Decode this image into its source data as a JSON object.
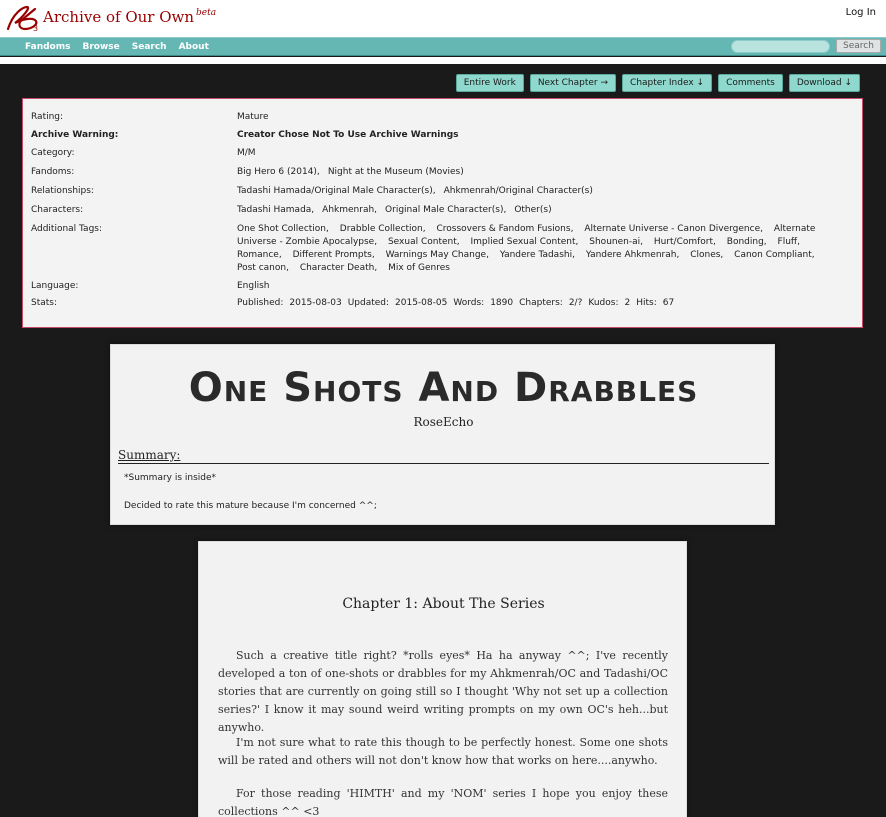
{
  "header": {
    "site_title": "Archive of Our Own",
    "beta_label": "beta",
    "login_label": "Log In",
    "nav": [
      "Fandoms",
      "Browse",
      "Search",
      "About"
    ],
    "search_placeholder": "",
    "search_button": "Search",
    "brand_color": "#990000",
    "nav_color": "#64b7b3"
  },
  "actions": [
    "Entire Work",
    "Next Chapter →",
    "Chapter Index ↓",
    "Comments",
    "Download ↓"
  ],
  "meta": {
    "rating_label": "Rating:",
    "rating": "Mature",
    "warning_label": "Archive Warning:",
    "warning": "Creator Chose Not To Use Archive Warnings",
    "category_label": "Category:",
    "category": "M/M",
    "fandoms_label": "Fandoms:",
    "fandoms": [
      "Big Hero 6 (2014),",
      "Night at the Museum (Movies)"
    ],
    "relationships_label": "Relationships:",
    "relationships": [
      "Tadashi Hamada/Original Male Character(s),",
      "Ahkmenrah/Original Character(s)"
    ],
    "characters_label": "Characters:",
    "characters": [
      "Tadashi Hamada,",
      "Ahkmenrah,",
      "Original Male Character(s),",
      "Other(s)"
    ],
    "tags_label": "Additional Tags:",
    "tags": [
      "One Shot Collection,",
      "Drabble Collection,",
      "Crossovers & Fandom Fusions,",
      "Alternate Universe - Canon Divergence,",
      "Alternate Universe - Zombie Apocalypse,",
      "Sexual Content,",
      "Implied Sexual Content,",
      "Shounen-ai,",
      "Hurt/Comfort,",
      "Bonding,",
      "Fluff,",
      "Romance,",
      "Different Prompts,",
      "Warnings May Change,",
      "Yandere Tadashi,",
      "Yandere Ahkmenrah,",
      "Clones,",
      "Canon Compliant,",
      "Post canon,",
      "Character Death,",
      "Mix of Genres"
    ],
    "language_label": "Language:",
    "language": "English",
    "stats_label": "Stats:",
    "stats": [
      "Published:",
      "2015-08-03",
      "Updated:",
      "2015-08-05",
      "Words:",
      "1890",
      "Chapters:",
      "2/?",
      "Kudos:",
      "2",
      "Hits:",
      "67"
    ]
  },
  "work": {
    "title": "One Shots And Drabbles",
    "author": "RoseEcho",
    "summary_heading": "Summary:",
    "summary_lines": [
      "*Summary is inside*",
      "Decided to rate this mature because I'm concerned ^^;"
    ]
  },
  "chapter": {
    "title": "Chapter 1: About The Series",
    "paragraphs": [
      "Such a creative title right? *rolls eyes* Ha ha anyway ^^; I've recently developed a ton of one-shots or drabbles for my Ahkmenrah/OC and Tadashi/OC stories that are currently on going still so I thought 'Why not set up a collection series?' I know it may sound weird writing prompts on my own OC's heh...but anywho.",
      "I'm not sure what to rate this though to be perfectly honest. Some one shots will be rated and others will not don't know how that works on here....anywho.",
      "For those reading 'HIMTH' and my 'NOM' series I hope you enjoy these collections ^^ <3"
    ]
  }
}
